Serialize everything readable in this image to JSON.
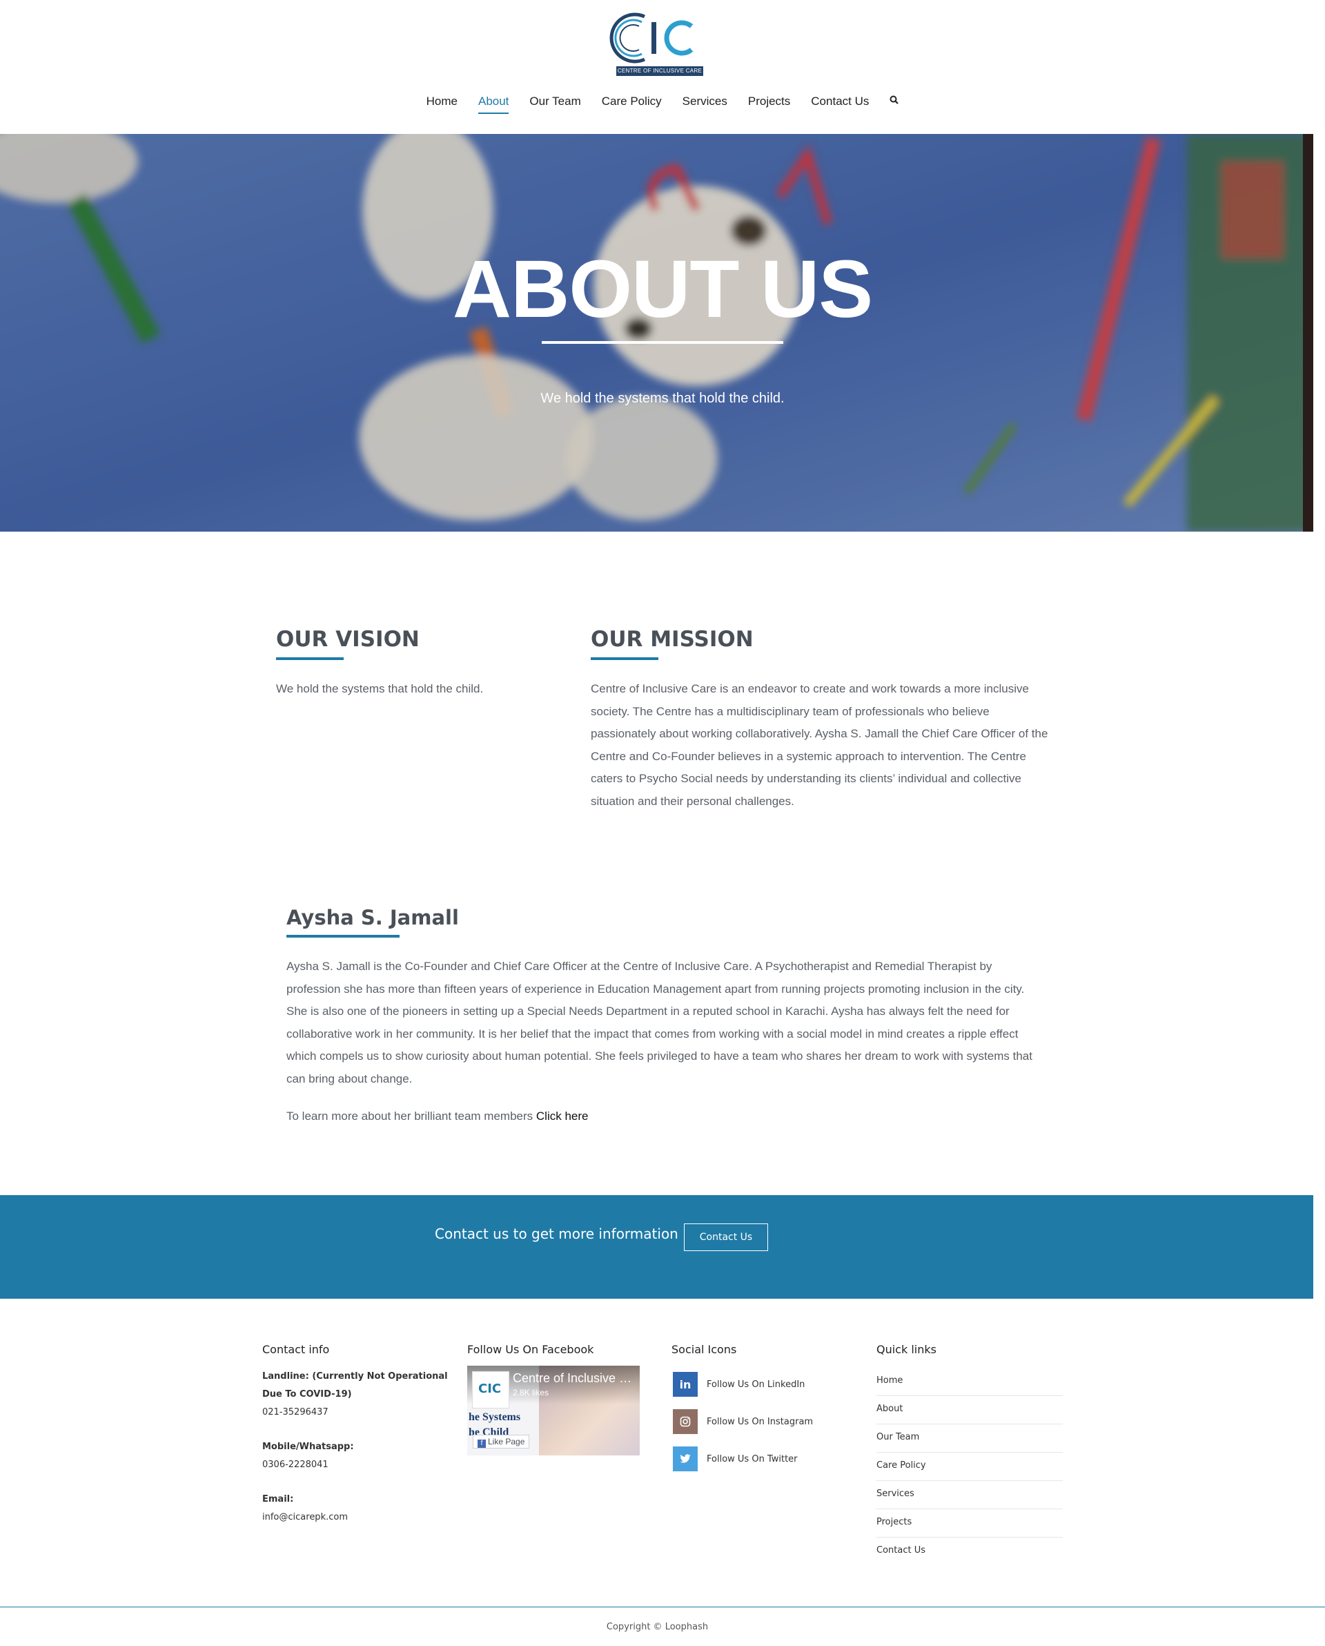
{
  "brand": {
    "logo_letters": "CIC",
    "logo_tagline": "CENTRE OF INCLUSIVE CARE",
    "primary_color": "#1f7aa6",
    "logo_navy": "#24446b"
  },
  "nav": {
    "items": [
      {
        "label": "Home"
      },
      {
        "label": "About",
        "active": true
      },
      {
        "label": "Our Team"
      },
      {
        "label": "Care Policy"
      },
      {
        "label": "Services"
      },
      {
        "label": "Projects"
      },
      {
        "label": "Contact Us"
      }
    ],
    "search_icon": "search-icon"
  },
  "hero": {
    "title": "ABOUT US",
    "subtitle": "We hold the systems that hold the child."
  },
  "vision": {
    "heading": "OUR VISION",
    "text": "We hold the systems that hold the child."
  },
  "mission": {
    "heading": "OUR MISSION",
    "text": "Centre of Inclusive Care is an endeavor to create and work towards a more inclusive society. The Centre has a multidisciplinary team of professionals who believe passionately about working collaboratively. Aysha S. Jamall the Chief Care Officer of the Centre and Co-Founder believes in a systemic approach to intervention. The Centre caters to Psycho Social needs by understanding its clients’ individual and collective situation and their personal challenges."
  },
  "founder": {
    "heading": "Aysha S. Jamall",
    "text": "Aysha S. Jamall is the Co-Founder and Chief Care Officer at the Centre of Inclusive Care. A Psychotherapist and Remedial Therapist by profession she has more than fifteen years of experience in Education Management apart from running projects promoting inclusion in the city. She is also one of the pioneers in setting up a Special Needs Department in a reputed school in Karachi. Aysha has always felt the need for collaborative work in her community. It is her belief that the impact that comes from working with a social model in mind creates a ripple effect which compels us to show curiosity about human potential. She feels privileged to have a team who shares her dream to work with systems that can bring about change.",
    "learn_more_prefix": "To learn more about her brilliant team members",
    "learn_more_link": "Click here"
  },
  "cta": {
    "text": "Contact us to get more information",
    "button": "Contact Us"
  },
  "footer": {
    "contact": {
      "title": "Contact info",
      "landline_label": "Landline: (Currently Not Operational Due To COVID-19)",
      "landline": "021-35296437",
      "mobile_label": "Mobile/Whatsapp:",
      "mobile": "0306-2228041",
      "email_label": "Email:",
      "email": "info@cicarepk.com"
    },
    "facebook": {
      "title": "Follow Us On Facebook",
      "page_name": "Centre of Inclusive Care",
      "likes": "2.8K likes",
      "avatar_text": "CIC",
      "slogan_line1": "he Systems",
      "slogan_line2": "he Child",
      "like_button": "Like Page"
    },
    "social": {
      "title": "Social Icons",
      "items": [
        {
          "label": "Follow Us On LinkedIn",
          "icon": "linkedin-icon",
          "color": "#2f67b0",
          "glyph": "in"
        },
        {
          "label": "Follow Us On Instagram",
          "icon": "instagram-icon",
          "color": "#8f6f64",
          "glyph": "◎"
        },
        {
          "label": "Follow Us On Twitter",
          "icon": "twitter-icon",
          "color": "#4aa1e0",
          "glyph": "🐦"
        }
      ]
    },
    "quick_links": {
      "title": "Quick links",
      "items": [
        "Home",
        "About",
        "Our Team",
        "Care Policy",
        "Services",
        "Projects",
        "Contact Us"
      ]
    },
    "copyright": "Copyright © Loophash"
  }
}
